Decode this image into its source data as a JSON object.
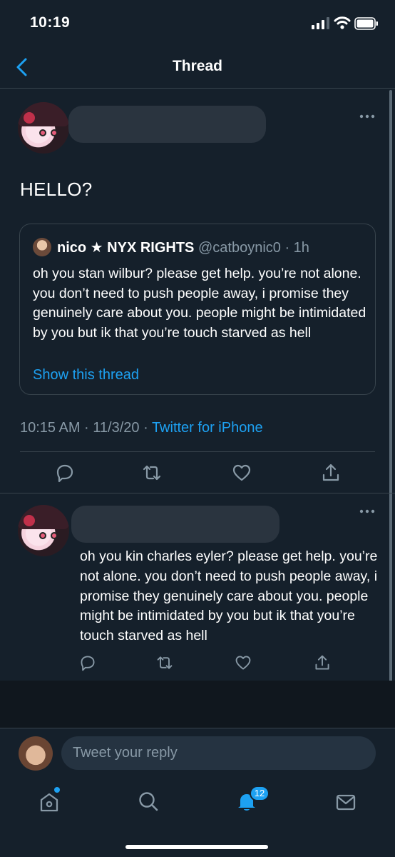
{
  "status_bar": {
    "time": "10:19"
  },
  "nav": {
    "title": "Thread"
  },
  "main_tweet": {
    "text": "HELLO?",
    "quote": {
      "name": "nico ★ NYX RIGHTS",
      "handle": "@catboynic0",
      "time": "· 1h",
      "body": "oh you stan wilbur? please get help. you’re not alone. you don’t need to push people away, i promise they genuinely care about you. people might be intimidated by you but ik that you’re touch starved as hell",
      "show_thread": "Show this thread"
    },
    "meta": {
      "timestamp": "10:15 AM · 11/3/20 · ",
      "source": "Twitter for iPhone"
    }
  },
  "reply_tweet": {
    "text": "oh you kin charles eyler? please get help. you’re not alone. you don’t need to push people away, i promise they genuinely care about you. people might be intimidated by you but ik that you’re touch starved as hell"
  },
  "composer": {
    "placeholder": "Tweet your reply"
  },
  "tab_bar": {
    "notifications_badge": "12"
  },
  "colors": {
    "background": "#15202b",
    "accent": "#1da1f2",
    "muted": "#8899a6",
    "divider": "#38444d"
  },
  "icons": [
    "back-chevron-icon",
    "more-icon",
    "reply-icon",
    "retweet-icon",
    "like-icon",
    "share-icon",
    "home-icon",
    "search-icon",
    "bell-icon",
    "mail-icon"
  ]
}
